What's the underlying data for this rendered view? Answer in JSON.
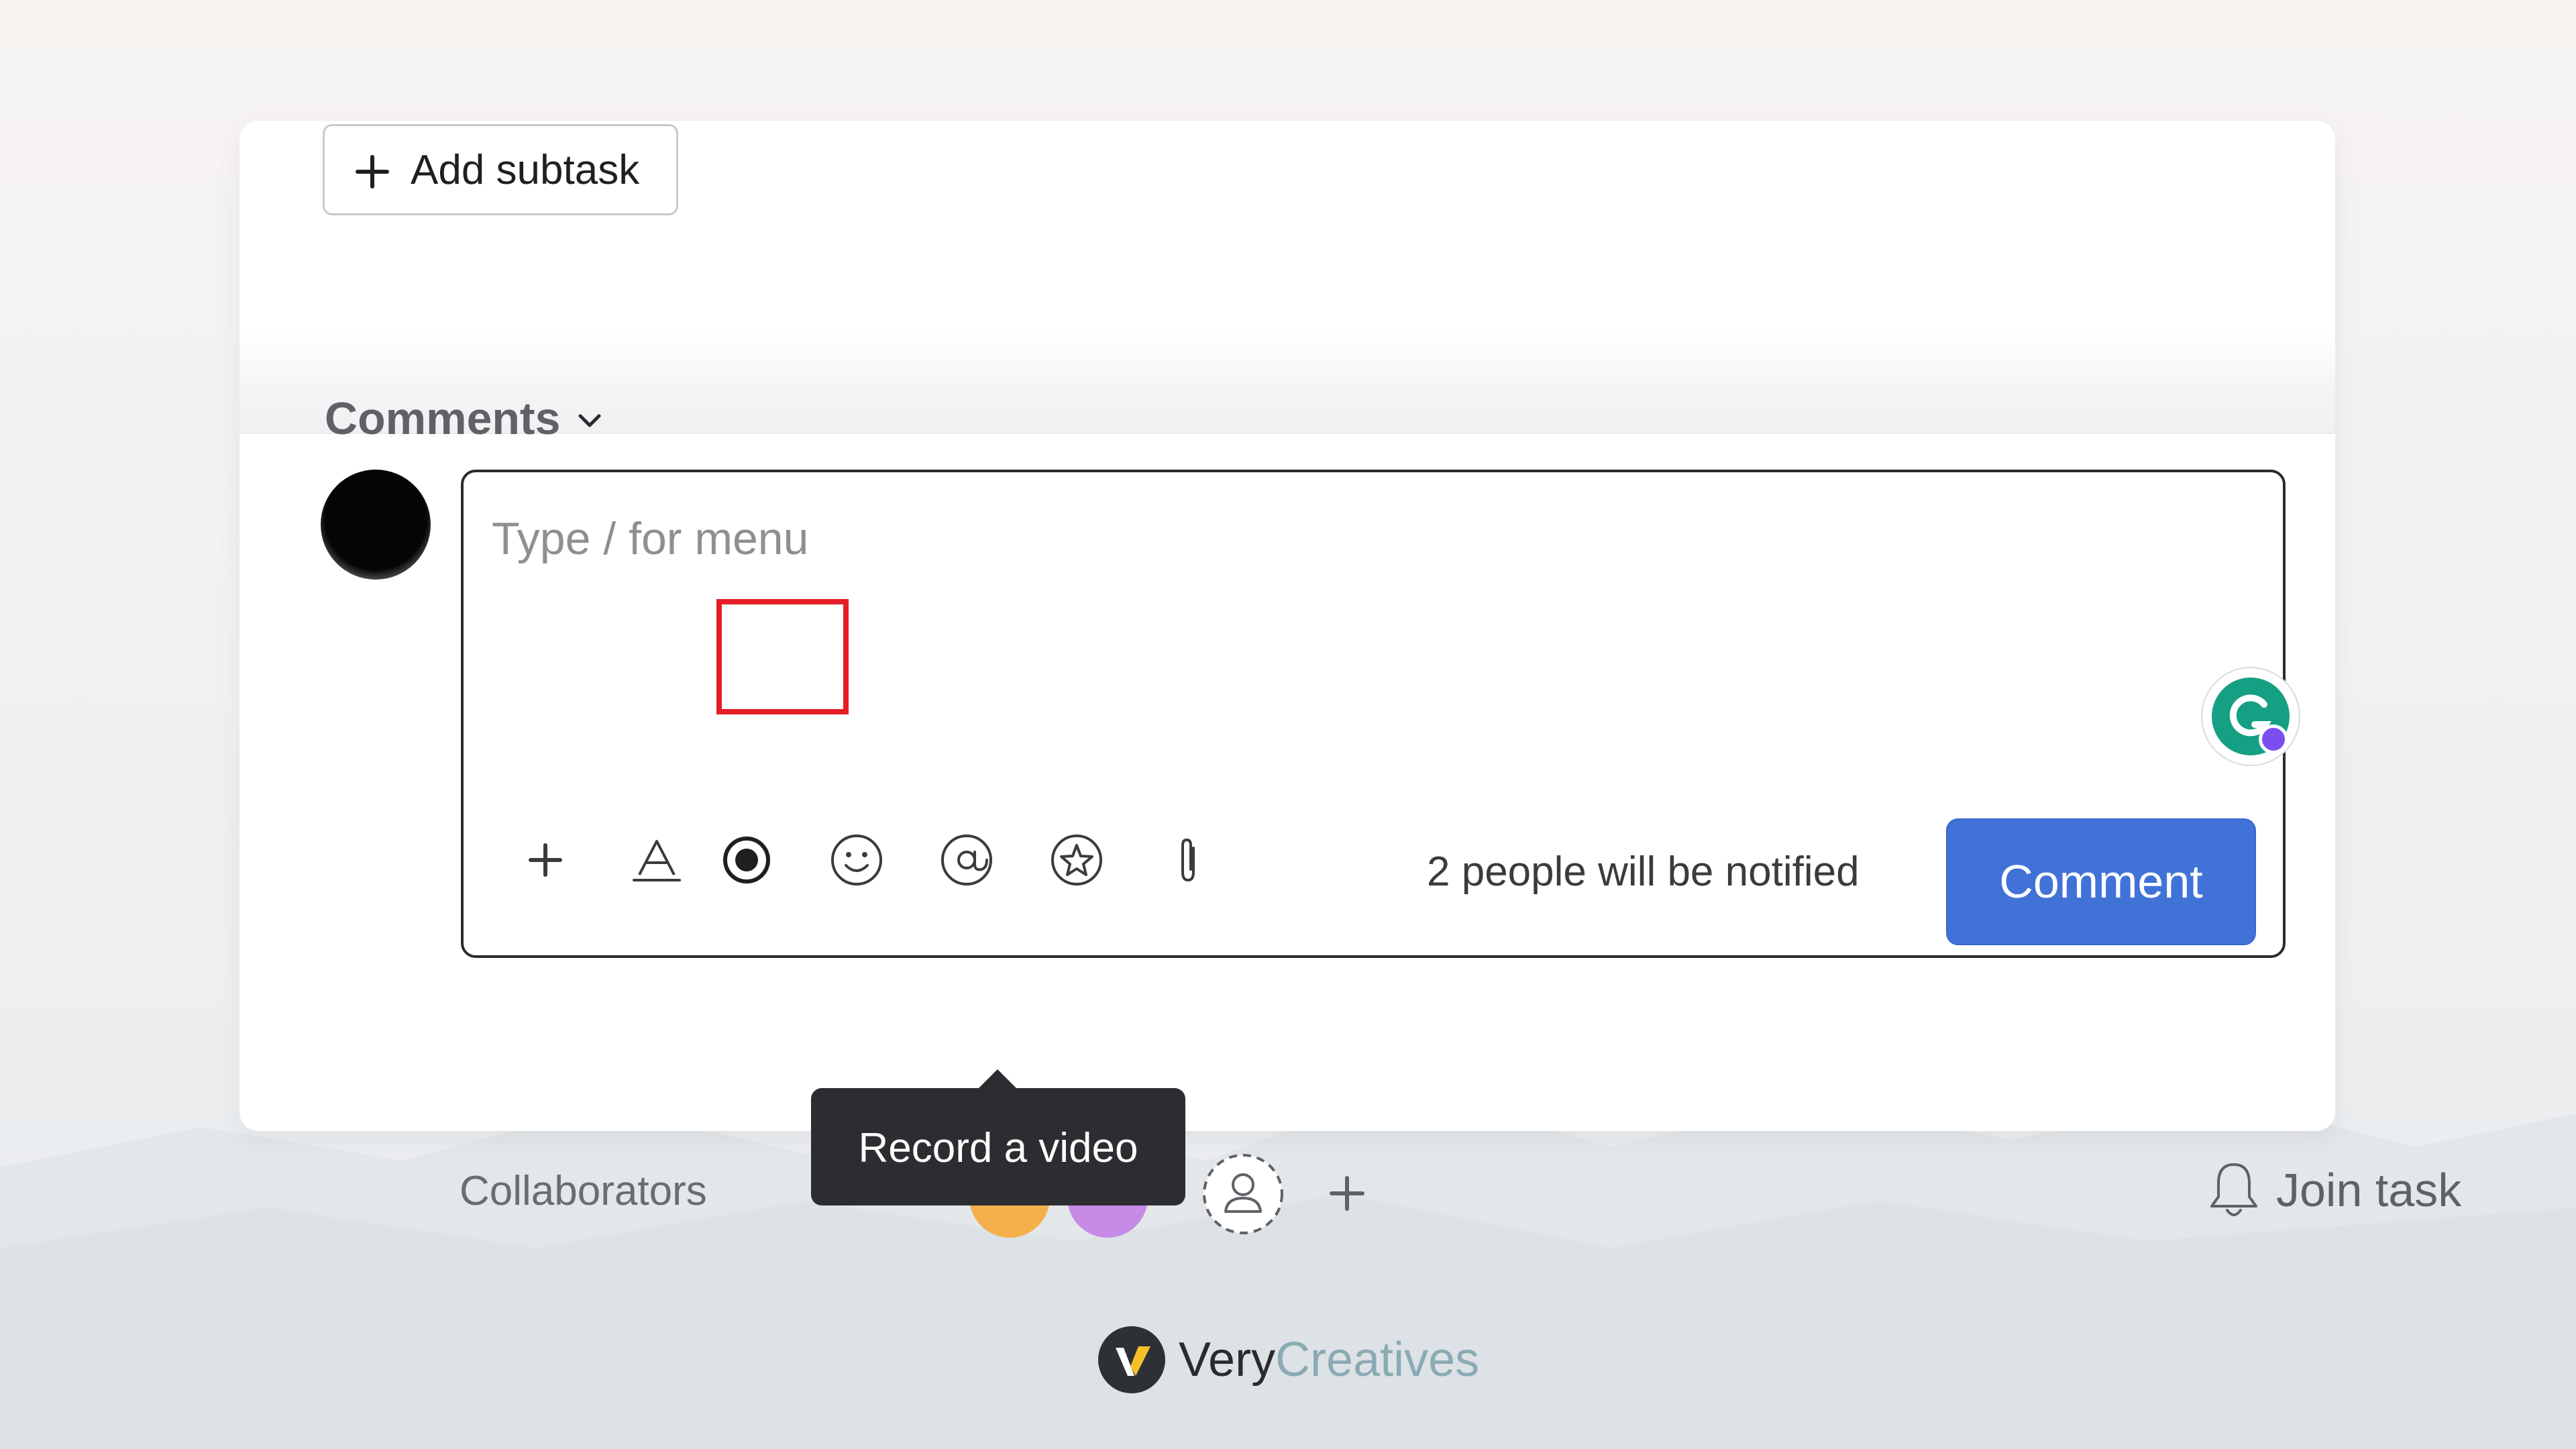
{
  "subtasks": {
    "add_label": "Add subtask"
  },
  "comments": {
    "section_label": "Comments",
    "placeholder": "Type / for menu",
    "notify_text": "2 people will be notified",
    "submit_label": "Comment"
  },
  "toolbar": {
    "tools": [
      "plus-icon",
      "text-format-icon",
      "record-video-icon",
      "emoji-icon",
      "mention-icon",
      "star-icon",
      "attachment-icon"
    ],
    "highlighted_tool": "record-video-icon",
    "highlight_color": "#e31e26",
    "tooltip": "Record a video"
  },
  "collaborators": {
    "label": "Collaborators",
    "avatar_colors": [
      "#f5b04c",
      "#c78ae6"
    ]
  },
  "task": {
    "join_label": "Join task"
  },
  "branding": {
    "logo_part1": "Very",
    "logo_part2": "Creatives"
  },
  "colors": {
    "primary_button": "#4172d8",
    "grammarly": "#15a084"
  }
}
